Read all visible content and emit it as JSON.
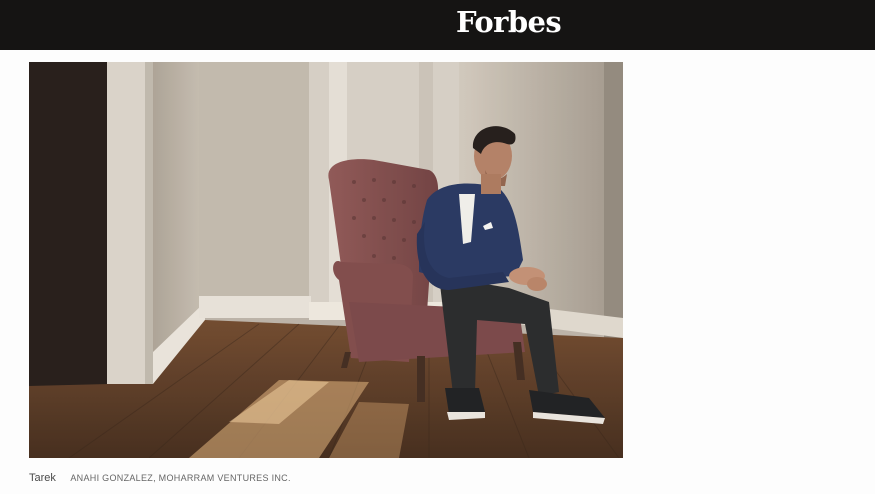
{
  "header": {
    "logo_text": "Forbes",
    "background_color": "#151413",
    "logo_color": "#ffffff"
  },
  "photo": {
    "subject": "man in navy blazer seated in tufted pink armchair in sunlit empty room"
  },
  "caption": {
    "title": "Tarek",
    "credit": "ANAHI GONZALEZ, MOHARRAM VENTURES INC."
  }
}
